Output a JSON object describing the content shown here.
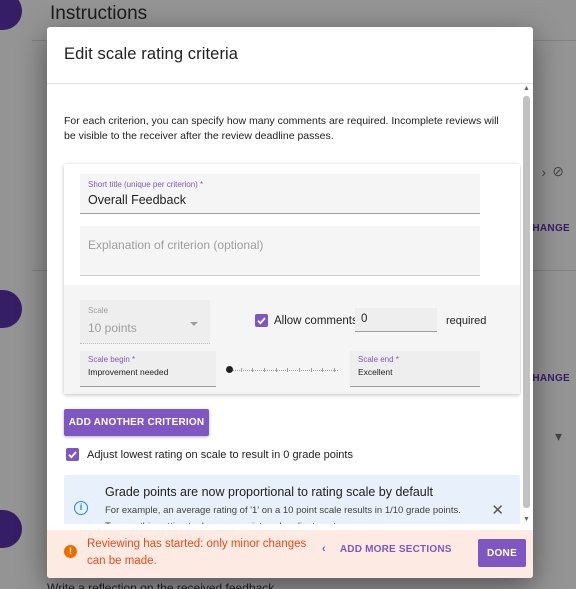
{
  "background": {
    "heading": "Instructions",
    "change_label_1": "CHANGE",
    "change_label_2": "CHANGE",
    "bottom_text": "Write a reflection on the received feedback"
  },
  "dialog": {
    "title": "Edit scale rating criteria",
    "intro": "For each criterion, you can specify how many comments are required. Incomplete reviews will be visible to the receiver after the review deadline passes.",
    "criterion": {
      "short_title_label": "Short title (unique per criterion) *",
      "short_title_value": "Overall Feedback",
      "explanation_placeholder": "Explanation of criterion (optional)",
      "scale_label": "Scale",
      "scale_value": "10 points",
      "allow_comments_label": "Allow comments,",
      "allow_comments_checked": true,
      "comments_count": "0",
      "required_label": "required",
      "scale_begin_label": "Scale begin *",
      "scale_begin_value": "Improvement needed",
      "scale_end_label": "Scale end *",
      "scale_end_value": "Excellent",
      "slider_value": 1,
      "slider_max": 10
    },
    "add_criterion_label": "ADD ANOTHER CRITERION",
    "adjust_label": "Adjust lowest rating on scale to result in 0 grade points",
    "adjust_checked": true,
    "info": {
      "title": "Grade points are now proportional to rating scale by default",
      "text": "For example, an average rating of '1' on a 10 point scale results in 1/10 grade points. Turn on this setting to do a zero-point scale adjustment.",
      "close_symbol": "✕",
      "icon_symbol": "i"
    },
    "footer": {
      "warning_symbol": "!",
      "warning": "Reviewing has started: only minor changes can be made.",
      "add_sections_label": "ADD MORE SECTIONS",
      "add_sections_chevron": "‹",
      "done_label": "DONE"
    }
  },
  "colors": {
    "accent": "#7e57c2",
    "warning": "#e64a19",
    "info": "#1e88e5"
  }
}
